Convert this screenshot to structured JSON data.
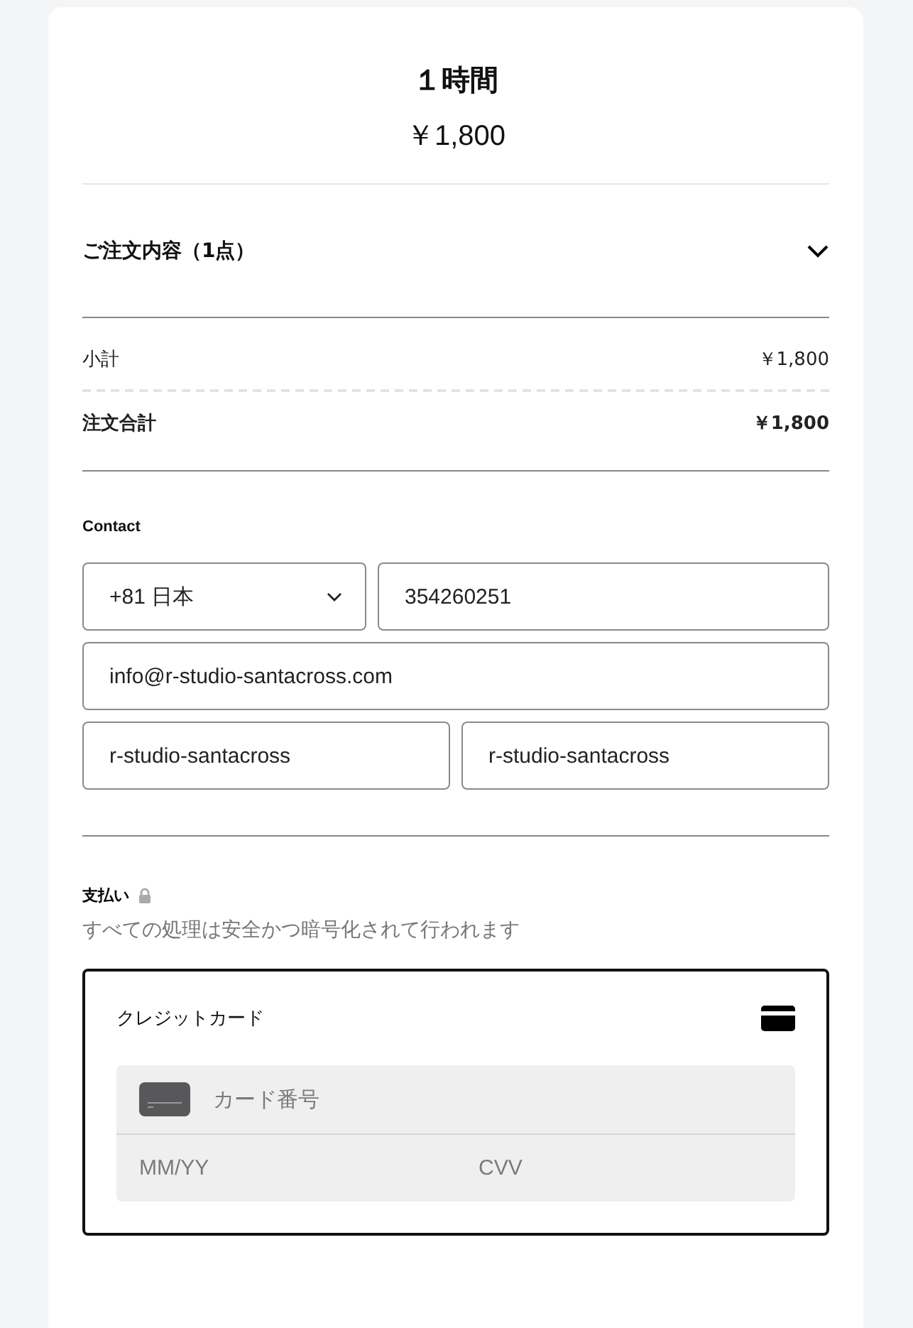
{
  "product": {
    "title": "１時間",
    "price": "￥1,800"
  },
  "order_summary": {
    "label": "ご注文内容（1点）",
    "expanded": false
  },
  "totals": [
    {
      "kind": "subtotal",
      "label": "小計",
      "value": "￥1,800"
    },
    {
      "kind": "total",
      "label": "注文合計",
      "value": "￥1,800"
    }
  ],
  "contact": {
    "heading": "Contact",
    "country_code": "+81 日本",
    "phone": "354260251",
    "email": "info@r-studio-santacross.com",
    "first_name": "r-studio-santacross",
    "last_name": "r-studio-santacross"
  },
  "payment": {
    "heading": "支払い",
    "description": "すべての処理は安全かつ暗号化されて行われます",
    "methods": [
      {
        "label": "クレジットカード",
        "selected": true,
        "card_number_placeholder": "カード番号",
        "expiry_placeholder": "MM/YY",
        "cvv_placeholder": "CVV"
      }
    ]
  }
}
